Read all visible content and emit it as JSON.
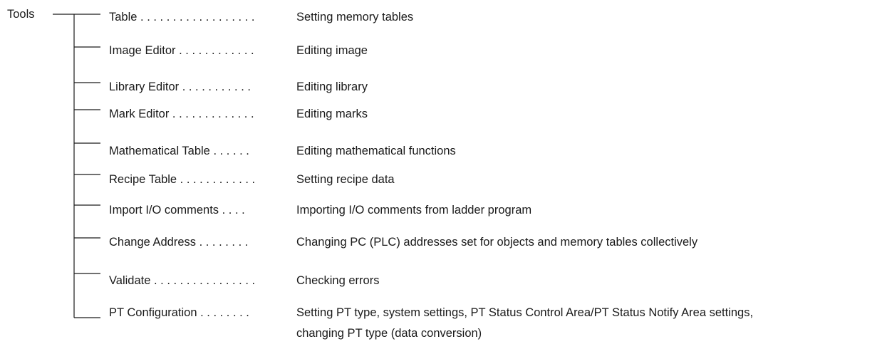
{
  "root": {
    "label": "Tools"
  },
  "items": [
    {
      "label": "Table . . . . . . . . . . . . . . . . . .",
      "desc": "Setting memory tables"
    },
    {
      "label": "Image Editor . . . . . . . . . . . .",
      "desc": "Editing image"
    },
    {
      "label": "Library Editor  . . . . . . . . . . .",
      "desc": "Editing library"
    },
    {
      "label": "Mark Editor . . . . . . . . . . . . .",
      "desc": "Editing marks"
    },
    {
      "label": "Mathematical Table . . . . . .",
      "desc": "Editing mathematical functions"
    },
    {
      "label": "Recipe Table . . . . . . . . . . . .",
      "desc": "Setting recipe data"
    },
    {
      "label": "Import I/O comments  . . . .",
      "desc": "Importing I/O comments from ladder program"
    },
    {
      "label": "Change Address  . . . . . . . .",
      "desc": "Changing PC (PLC) addresses set for objects and memory tables collectively"
    },
    {
      "label": "Validate . . . . . . . . . . . . . . . .",
      "desc": "Checking errors"
    },
    {
      "label": "PT Configuration  . . . . . . . .",
      "desc": "Setting PT type, system settings, PT Status Control Area/PT Status Notify Area settings,",
      "desc2": "changing PT type (data conversion)"
    }
  ]
}
